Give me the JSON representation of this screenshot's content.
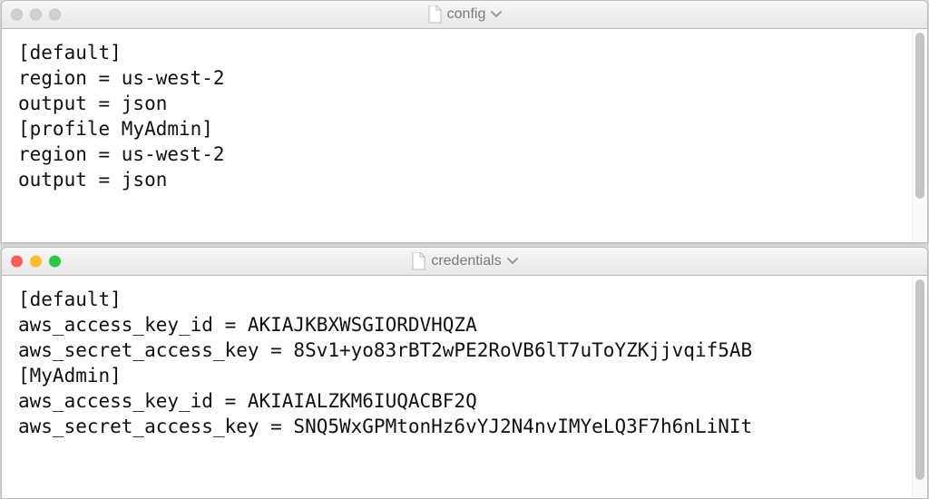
{
  "windows": [
    {
      "id": "config",
      "title": "config",
      "active": false,
      "lines": [
        "[default]",
        "region = us-west-2",
        "output = json",
        "[profile MyAdmin]",
        "region = us-west-2",
        "output = json"
      ]
    },
    {
      "id": "credentials",
      "title": "credentials",
      "active": true,
      "lines": [
        "[default]",
        "aws_access_key_id = AKIAJKBXWSGIORDVHQZA",
        "aws_secret_access_key = 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",
        "[MyAdmin]",
        "aws_access_key_id = AKIAIALZKM6IUQACBF2Q",
        "aws_secret_access_key = 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"
      ]
    }
  ]
}
